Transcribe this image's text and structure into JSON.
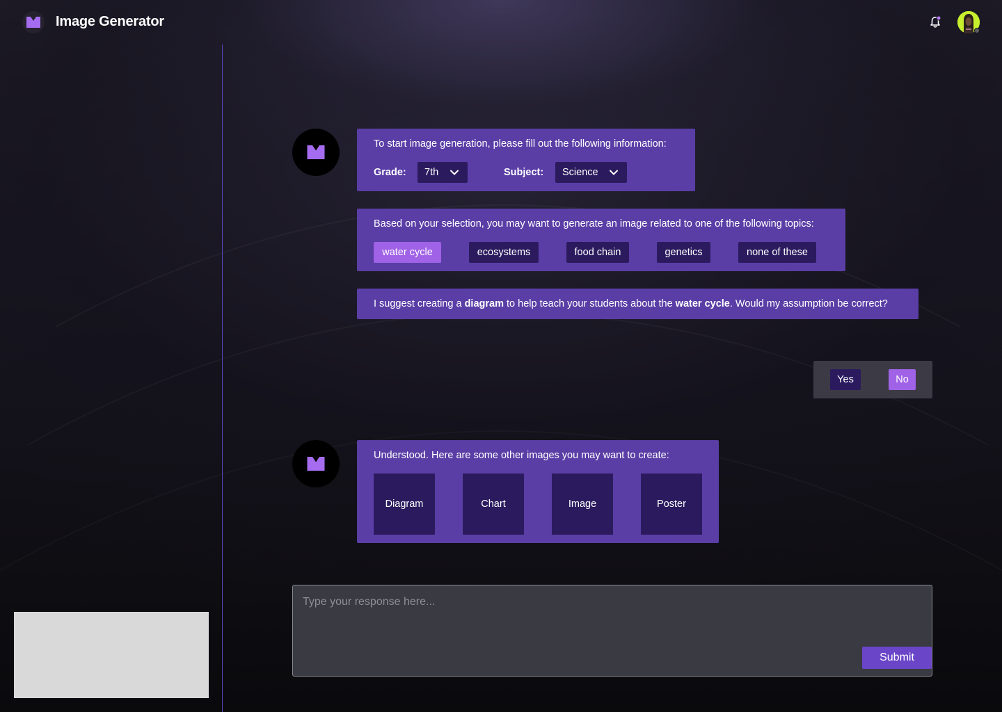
{
  "app": {
    "title": "Image Generator"
  },
  "colors": {
    "accent": "#5a3ea6",
    "chip_bg": "#2b1b5e",
    "chip_active": "#a062e6",
    "logo_purple": "#a66cf0",
    "avatar_bg": "#c7ef2e"
  },
  "header": {
    "notification_icon": "bell-icon",
    "avatar_icon": "user-avatar"
  },
  "chat": {
    "intro": {
      "text": "To start image generation, please fill out the following information:",
      "grade_label": "Grade:",
      "grade_value": "7th",
      "subject_label": "Subject:",
      "subject_value": "Science"
    },
    "topics": {
      "text": "Based on your selection, you may want to generate an image related to one of the following topics:",
      "chips": [
        {
          "label": "water cycle",
          "selected": true
        },
        {
          "label": "ecosystems",
          "selected": false
        },
        {
          "label": "food chain",
          "selected": false
        },
        {
          "label": "genetics",
          "selected": false
        },
        {
          "label": "none of these",
          "selected": false
        }
      ]
    },
    "suggestion": {
      "part1": "I suggest creating a ",
      "bold1": "diagram",
      "part2": " to help teach your students about the ",
      "bold2": "water cycle",
      "part3": ". Would my assumption be correct?"
    },
    "reply": {
      "yes": "Yes",
      "no": "No",
      "selected": "No"
    },
    "alternatives": {
      "text": "Understood. Here are some other images you may want to create:",
      "options": [
        "Diagram",
        "Chart",
        "Image",
        "Poster"
      ]
    }
  },
  "composer": {
    "placeholder": "Type your response here...",
    "submit_label": "Submit"
  }
}
